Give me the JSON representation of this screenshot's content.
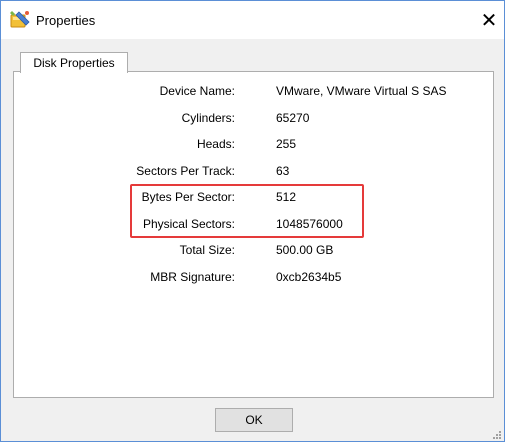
{
  "window": {
    "title": "Properties",
    "close_glyph": "✕"
  },
  "tabs": [
    {
      "label": "Disk Properties"
    }
  ],
  "properties": [
    {
      "label": "Device Name:",
      "value": "VMware, VMware Virtual S SAS"
    },
    {
      "label": "Cylinders:",
      "value": "65270"
    },
    {
      "label": "Heads:",
      "value": "255"
    },
    {
      "label": "Sectors Per Track:",
      "value": "63"
    },
    {
      "label": "Bytes Per Sector:",
      "value": "512"
    },
    {
      "label": "Physical Sectors:",
      "value": "1048576000"
    },
    {
      "label": "Total Size:",
      "value": "500.00 GB"
    },
    {
      "label": "MBR Signature:",
      "value": "0xcb2634b5"
    }
  ],
  "buttons": {
    "ok_label": "OK"
  },
  "colors": {
    "highlight_border": "#e53a3a",
    "window_border": "#5b8fd6"
  },
  "icons": {
    "app": "partition-wizard-app-icon",
    "close": "close-icon",
    "resize": "resize-grip-icon"
  }
}
